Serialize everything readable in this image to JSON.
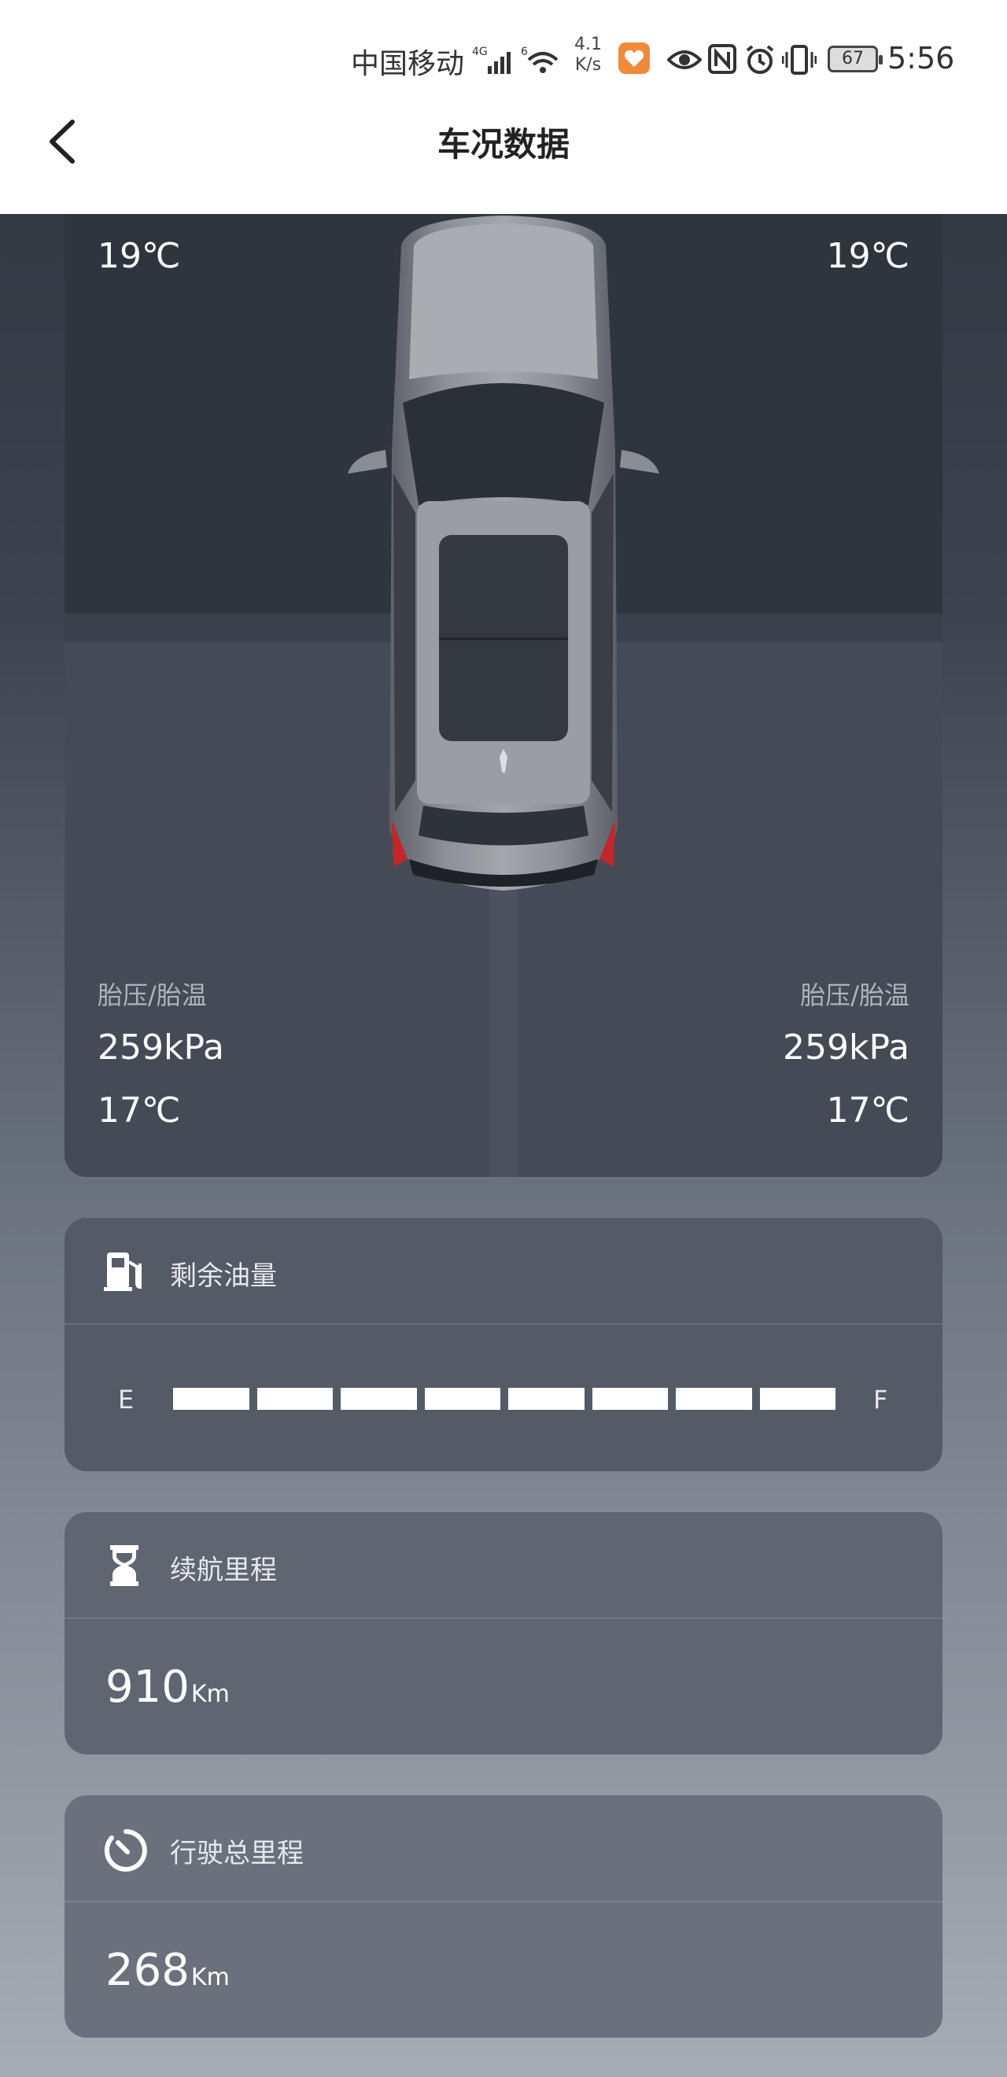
{
  "status_bar": {
    "carrier": "中国移动",
    "speed": "4.1\nK/s",
    "battery": "67",
    "time": "5:56"
  },
  "header": {
    "title": "车况数据"
  },
  "tires": {
    "front_left": {
      "temp": "19℃"
    },
    "front_right": {
      "temp": "19℃"
    },
    "rear_left": {
      "label": "胎压/胎温",
      "pressure": "259kPa",
      "temp": "17℃"
    },
    "rear_right": {
      "label": "胎压/胎温",
      "pressure": "259kPa",
      "temp": "17℃"
    }
  },
  "fuel": {
    "title": "剩余油量",
    "empty_label": "E",
    "full_label": "F",
    "segments_total": 8,
    "segments_filled": 8
  },
  "range": {
    "title": "续航里程",
    "value": "910",
    "unit": "Km"
  },
  "odometer": {
    "title": "行驶总里程",
    "value": "268",
    "unit": "Km"
  },
  "colors": {
    "fuel_segment": "#ffffff",
    "brake_light": "#c0262b",
    "app_icon": "#f08a3a"
  }
}
